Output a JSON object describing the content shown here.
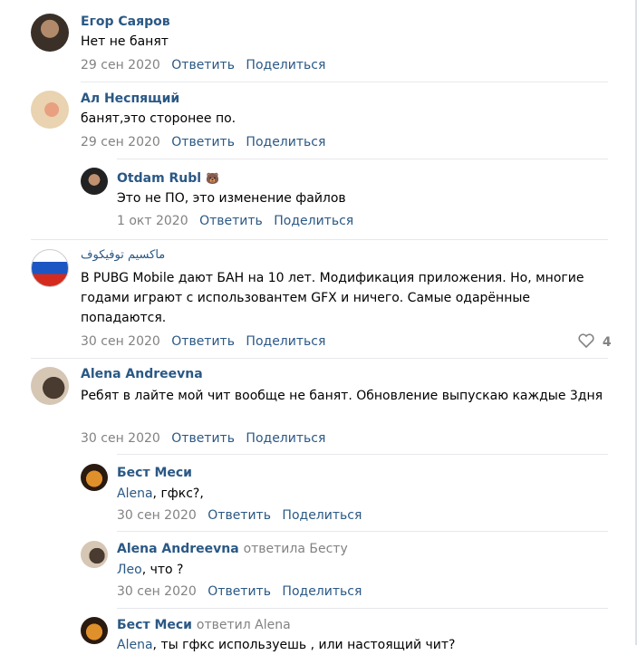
{
  "comments": [
    {
      "author": "Егор Саяров",
      "text": "Нет не банят",
      "date": "29 сен 2020",
      "reply": "Ответить",
      "share": "Поделиться"
    },
    {
      "author": "Ал Неспящий",
      "text": "банят,это сторонее по.",
      "date": "29 сен 2020",
      "reply": "Ответить",
      "share": "Поделиться"
    },
    {
      "author": "Otdam Rubl",
      "author_badge": "🐻",
      "text": "Это не ПО, это изменение файлов",
      "date": "1 окт 2020",
      "reply": "Ответить",
      "share": "Поделиться"
    },
    {
      "author": "ماكسيم توفيكوف",
      "text": "В PUBG Mobile дают БАН на 10 лет. Модификация приложения. Но, многие годами играют с использовантем GFX и ничего. Самые одарённые попадаются.",
      "date": "30 сен 2020",
      "reply": "Ответить",
      "share": "Поделиться",
      "likes": "4"
    },
    {
      "author": "Alena Andreevna",
      "text": "Ребят в лайте мой чит вообще не банят. Обновление выпускаю каждые 3дня",
      "date": "30 сен 2020",
      "reply": "Ответить",
      "share": "Поделиться"
    },
    {
      "author": "Бест Меси",
      "mention": "Alena",
      "text": ", гфкс?,",
      "date": "30 сен 2020",
      "reply": "Ответить",
      "share": "Поделиться"
    },
    {
      "author": "Alena Andreevna",
      "reply_to": "ответила Бесту",
      "mention": "Лео",
      "text": ", что ?",
      "date": "30 сен 2020",
      "reply": "Ответить",
      "share": "Поделиться"
    },
    {
      "author": "Бест Меси",
      "reply_to": "ответил Alena",
      "mention": "Alena",
      "text": ", ты гфкс используешь , или настоящий чит?"
    }
  ],
  "colors": {
    "link": "#2a5885",
    "meta": "#828282",
    "separator": "#e7e8ec"
  }
}
